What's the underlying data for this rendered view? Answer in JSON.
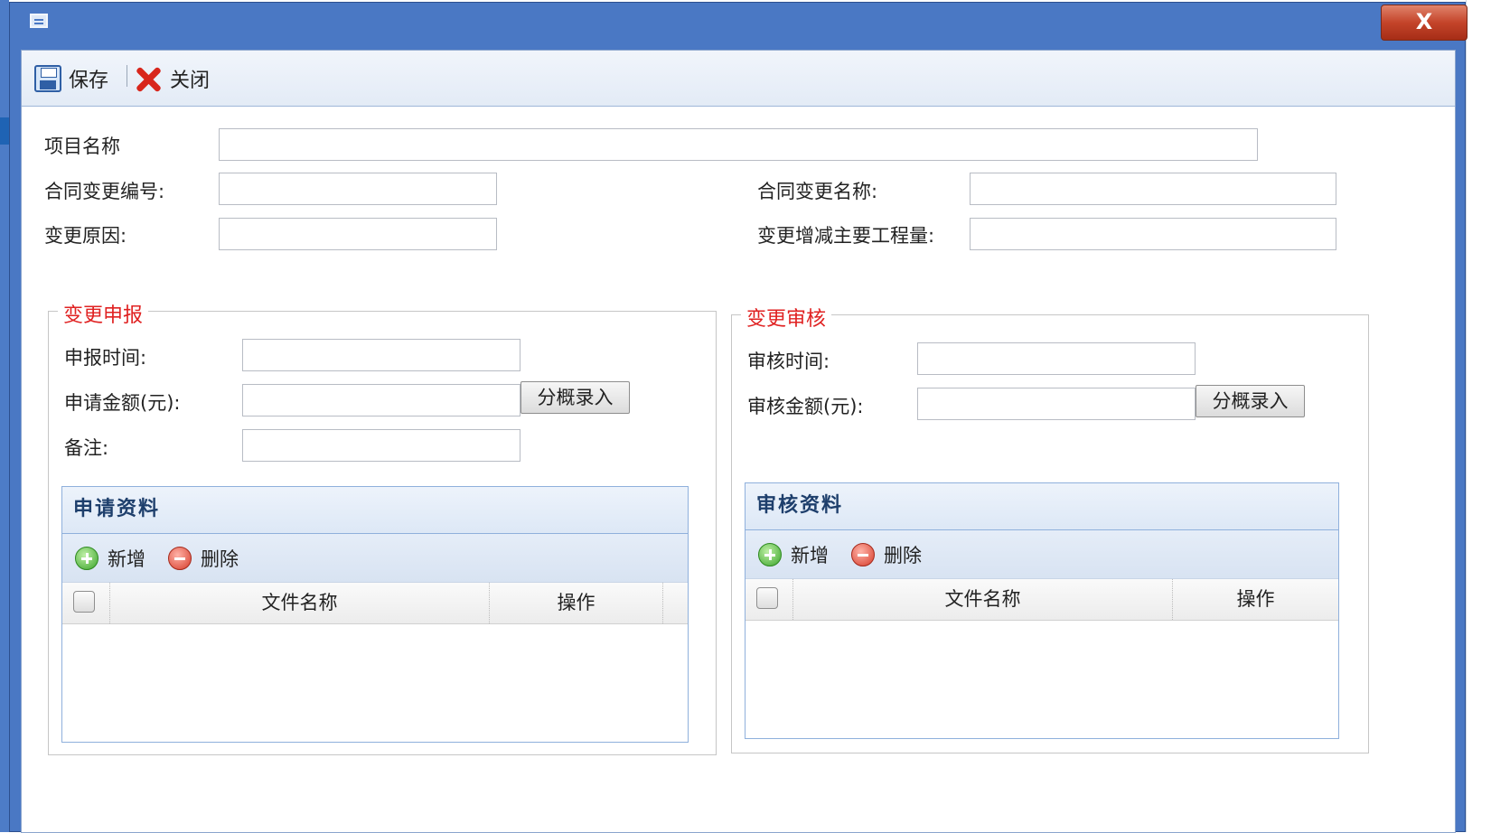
{
  "toolbar": {
    "save_label": "保存",
    "close_label": "关闭"
  },
  "window": {
    "close_glyph": "X"
  },
  "form": {
    "project_name_label": "项目名称",
    "change_no_label": "合同变更编号:",
    "change_name_label": "合同变更名称:",
    "reason_label": "变更原因:",
    "quantity_label": "变更增减主要工程量:"
  },
  "apply": {
    "legend": "变更申报",
    "time_label": "申报时间:",
    "amount_label": "申请金额(元):",
    "split_button": "分概录入",
    "remark_label": "备注:",
    "panel_title": "申请资料",
    "add_label": "新增",
    "delete_label": "删除",
    "col_filename": "文件名称",
    "col_action": "操作"
  },
  "review": {
    "legend": "变更审核",
    "time_label": "审核时间:",
    "amount_label": "审核金额(元):",
    "split_button": "分概录入",
    "panel_title": "审核资料",
    "add_label": "新增",
    "delete_label": "删除",
    "col_filename": "文件名称",
    "col_action": "操作"
  },
  "colors": {
    "title_bar": "#4a78c4",
    "legend": "#e02222",
    "panel_border": "#8fb0dc"
  },
  "icons": [
    "window-icon",
    "close-x-icon",
    "save-icon",
    "close-icon",
    "add-icon",
    "delete-icon"
  ]
}
